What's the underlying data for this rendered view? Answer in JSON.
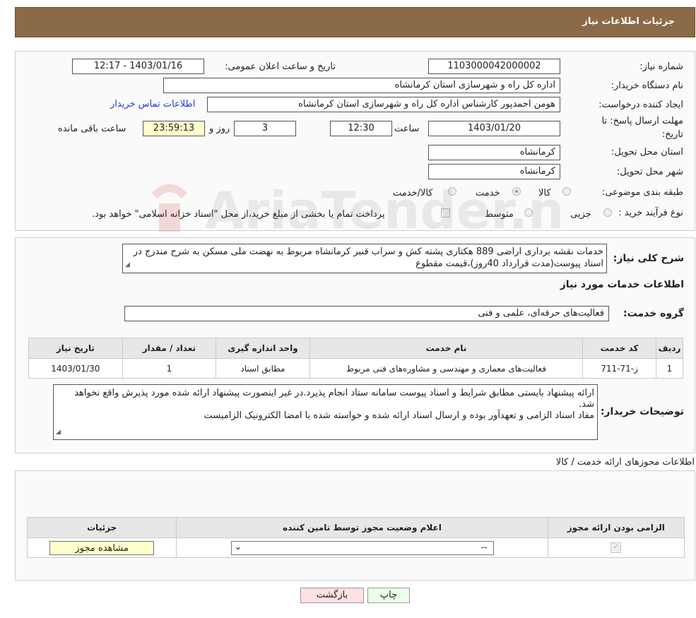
{
  "header": {
    "title": "جزئیات اطلاعات نیاز"
  },
  "form": {
    "need_number_label": "شماره نیاز:",
    "need_number": "1103000042000002",
    "announce_label": "تاریخ و ساعت اعلان عمومی:",
    "announce_value": "1403/01/16 - 12:17",
    "buyer_label": "نام دستگاه خریدار:",
    "buyer_value": "اداره کل راه و شهرسازی استان کرمانشاه",
    "creator_label": "ایجاد کننده درخواست:",
    "creator_value": "هومن احمدپور کارشناس اداره کل راه و شهرسازی استان کرمانشاه",
    "contact_link": "اطلاعات تماس خریدار",
    "deadline_label_1": "مهلت ارسال پاسخ: تا",
    "deadline_label_2": "تاریخ:",
    "deadline_date": "1403/01/20",
    "time_label": "ساعت",
    "deadline_time": "12:30",
    "days_value": "3",
    "days_label": "روز و",
    "remaining_time": "23:59:13",
    "remaining_label": "ساعت باقی مانده",
    "province_label": "استان محل تحویل:",
    "province_value": "کرمانشاه",
    "city_label": "شهر محل تحویل:",
    "city_value": "کرمانشاه",
    "category_label": "طبقه بندی موضوعی:",
    "category_options": [
      "کالا",
      "خدمت",
      "کالا/خدمت"
    ],
    "category_selected": "خدمت",
    "process_label": "نوع فرآیند خرید :",
    "process_options": [
      "جزیی",
      "متوسط"
    ],
    "payment_note": "پرداخت تمام یا بخشی از مبلغ خرید،از محل \"اسناد خزانه اسلامی\" خواهد بود."
  },
  "description": {
    "label": "شرح کلی نیاز:",
    "text": "خدمات نقشه برداری اراضی 889 هکتاری پشته کش و سراب قنبر کرمانشاه مربوط به نهضت ملی مسکن به شرح مندرج در اسناد پیوست(مدت قرارداد 40روز)،قیمت مقطوع"
  },
  "services": {
    "section_title": "اطلاعات خدمات مورد نیاز",
    "group_label": "گروه خدمت:",
    "group_value": "فعالیت‌های حرفه‌ای، علمی و فنی",
    "columns": [
      "ردیف",
      "کد خدمت",
      "نام خدمت",
      "واحد اندازه گیری",
      "تعداد / مقدار",
      "تاریخ نیاز"
    ],
    "rows": [
      {
        "row": "1",
        "code": "ز-71-711",
        "name": "فعالیت‌های معماری و مهندسی و مشاوره‌های فنی مربوط",
        "unit": "مطابق اسناد",
        "qty": "1",
        "date": "1403/01/30"
      }
    ]
  },
  "buyer_notes": {
    "label": "توضیحات خریدار:",
    "line1": "ارائه پیشنهاد بایستی مطابق شرایط و اسناد پیوست سامانه ستاد انجام پذیرد.در غیر اینصورت پیشنهاد ارائه شده مورد پذیرش واقع نخواهد شد.",
    "line2": "مفاد اسناد الزامی و تعهدآور بوده و ارسال اسناد ارائه شده و خواسته شده با امضا الکترونیک الزامیست"
  },
  "permits": {
    "section_title": "اطلاعات مجوزهای ارائه خدمت / کالا",
    "columns": [
      "الزامی بودن ارائه مجوز",
      "اعلام وضعیت مجوز توسط تامین کننده",
      "جزئیات"
    ],
    "select_value": "--",
    "view_button": "مشاهده مجوز"
  },
  "buttons": {
    "print": "چاپ",
    "back": "بازگشت"
  },
  "watermark": {
    "text": "AriaTender.net"
  },
  "colors": {
    "header_bg": "#8b6a48",
    "link": "#1a3fd1",
    "print_bg": "#eaffea",
    "back_bg": "#ffe1e1"
  }
}
